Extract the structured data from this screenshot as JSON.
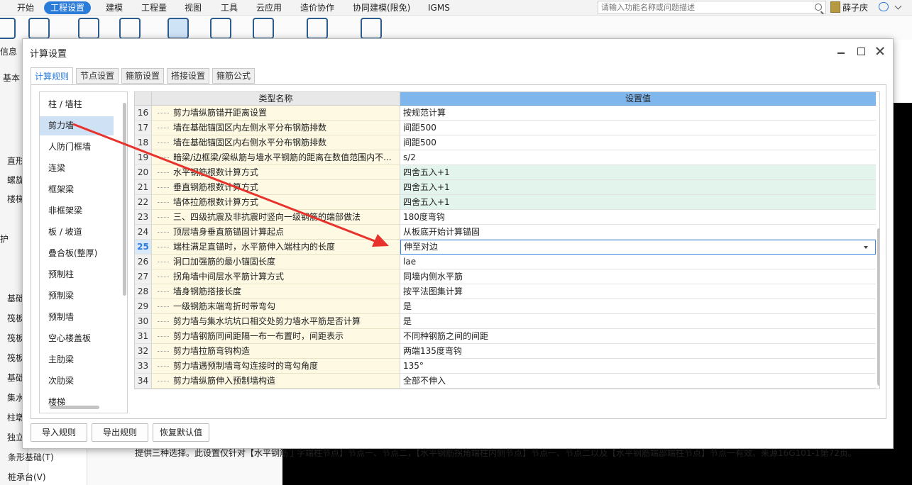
{
  "menubar": {
    "items": [
      "开始",
      "工程设置",
      "建模",
      "工程量",
      "视图",
      "工具",
      "云应用",
      "造价协作",
      "协同建模(限免)",
      "IGMS"
    ],
    "active_index": 1,
    "search_placeholder": "请输入功能名称或问题描述",
    "user_name": "薛子庆"
  },
  "background": {
    "left_labels": [
      "信息",
      "基本",
      "直形",
      "螺旋",
      "楼梯",
      "护",
      "基础",
      "筏板",
      "筏板",
      "筏板",
      "基础",
      "集水",
      "柱墩",
      "独立",
      "条形基础(T)",
      "桩承台(V)"
    ]
  },
  "dialog": {
    "title": "计算设置",
    "tabs": [
      "计算规则",
      "节点设置",
      "箍筋设置",
      "搭接设置",
      "箍筋公式"
    ],
    "active_tab": 0,
    "categories": [
      "柱 / 墙柱",
      "剪力墙",
      "人防门框墙",
      "连梁",
      "框架梁",
      "非框架梁",
      "板 / 坡道",
      "叠合板(整厚)",
      "预制柱",
      "预制梁",
      "预制墙",
      "空心楼盖板",
      "主肋梁",
      "次肋梁",
      "楼梯"
    ],
    "selected_category": 1,
    "grid": {
      "header_name": "类型名称",
      "header_value": "设置值",
      "rows": [
        {
          "num": "16",
          "name": "剪力墙纵筋错开距离设置",
          "value": "按规范计算",
          "green": false
        },
        {
          "num": "17",
          "name": "墙在基础锚固区内左侧水平分布钢筋排数",
          "value": "间距500",
          "green": false
        },
        {
          "num": "18",
          "name": "墙在基础锚固区内右侧水平分布钢筋排数",
          "value": "间距500",
          "green": false
        },
        {
          "num": "19",
          "name": "暗梁/边框梁/梁纵筋与墙水平钢筋的距离在数值范围内不...",
          "value": "s/2",
          "green": false
        },
        {
          "num": "20",
          "name": "水平钢筋根数计算方式",
          "value": "四舍五入+1",
          "green": true
        },
        {
          "num": "21",
          "name": "垂直钢筋根数计算方式",
          "value": "四舍五入+1",
          "green": true
        },
        {
          "num": "22",
          "name": "墙体拉筋根数计算方式",
          "value": "四舍五入+1",
          "green": true
        },
        {
          "num": "23",
          "name": "三、四级抗震及非抗震时竖向一级钢筋的端部做法",
          "value": "180度弯钩",
          "green": false
        },
        {
          "num": "24",
          "name": "顶层墙身垂直筋锚固计算起点",
          "value": "从板底开始计算锚固",
          "green": false
        },
        {
          "num": "25",
          "name": "端柱满足直锚时，水平筋伸入端柱内的长度",
          "value": "伸至对边",
          "green": false,
          "current": true
        },
        {
          "num": "26",
          "name": "洞口加强筋的最小锚固长度",
          "value": "lae",
          "green": false
        },
        {
          "num": "27",
          "name": "拐角墙中间层水平筋计算方式",
          "value": "同墙内侧水平筋",
          "green": false
        },
        {
          "num": "28",
          "name": "墙身钢筋搭接长度",
          "value": "按平法图集计算",
          "green": false
        },
        {
          "num": "29",
          "name": "一级钢筋末端弯折时带弯勾",
          "value": "是",
          "green": false
        },
        {
          "num": "30",
          "name": "剪力墙与集水坑坑口相交处剪力墙水平筋是否计算",
          "value": "是",
          "green": false
        },
        {
          "num": "31",
          "name": "剪力墙钢筋同间距隔一布一布置时，间距表示",
          "value": "不同种钢筋之间的间距",
          "green": false
        },
        {
          "num": "32",
          "name": "剪力墙拉筋弯钩构造",
          "value": "两端135度弯钩",
          "green": false
        },
        {
          "num": "33",
          "name": "剪力墙遇预制墙弯勾连接时的弯勾角度",
          "value": "135°",
          "green": false
        },
        {
          "num": "34",
          "name": "剪力墙纵筋伸入预制墙构造",
          "value": "全部不伸入",
          "green": false
        }
      ]
    },
    "hint": "提供三种选择。此设置仅针对【水平钢筋丁字端柱节点】节点一、节点二，【水平钢筋拐角端柱内侧节点】节点一、节点二以及【水平钢筋端部端柱节点】节点一有效。来源16G101-1第72页。",
    "buttons": [
      "导入规则",
      "导出规则",
      "恢复默认值"
    ]
  },
  "annotation": {
    "color": "#e8322c"
  }
}
